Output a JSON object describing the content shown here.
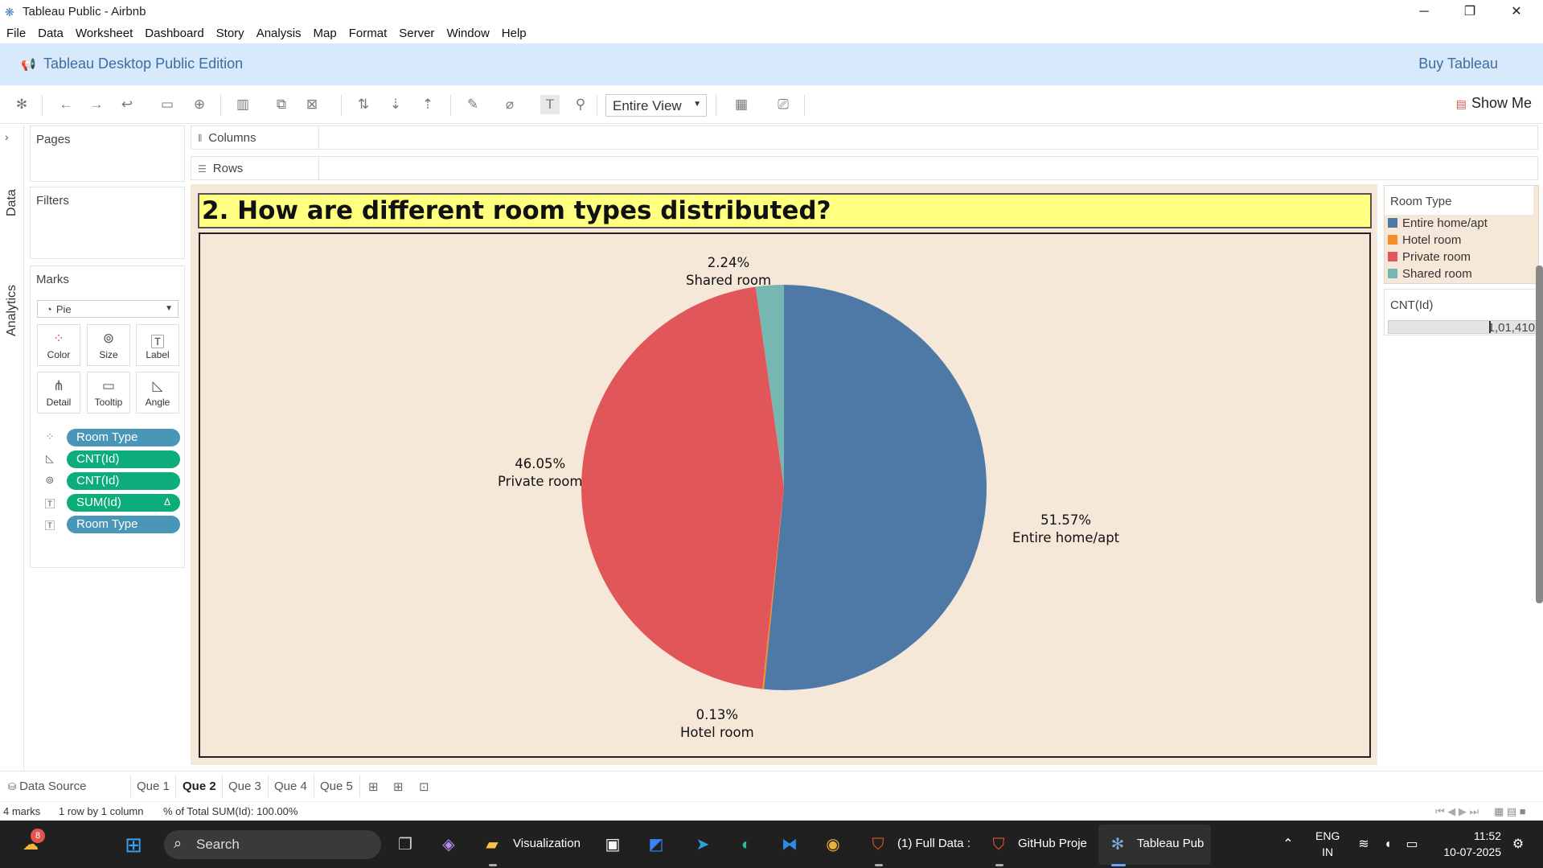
{
  "window": {
    "title": "Tableau Public - Airbnb",
    "minimize": "─",
    "restore": "❐",
    "close": "✕"
  },
  "menu": [
    "File",
    "Data",
    "Worksheet",
    "Dashboard",
    "Story",
    "Analysis",
    "Map",
    "Format",
    "Server",
    "Window",
    "Help"
  ],
  "banner": {
    "edition": "Tableau Desktop Public Edition",
    "buy": "Buy Tableau"
  },
  "toolbar": {
    "fit": "Entire View",
    "show_me": "Show Me"
  },
  "rail": {
    "data_tab": "Data",
    "analytics_tab": "Analytics"
  },
  "pages": {
    "title": "Pages"
  },
  "filters": {
    "title": "Filters"
  },
  "marks": {
    "title": "Marks",
    "mark_type": "Pie",
    "buttons": [
      "Color",
      "Size",
      "Label",
      "Detail",
      "Tooltip",
      "Angle"
    ],
    "pills": [
      {
        "field": "Room Type",
        "kind": "color"
      },
      {
        "field": "CNT(Id)",
        "kind": "angle"
      },
      {
        "field": "CNT(Id)",
        "kind": "size"
      },
      {
        "field": "SUM(Id)",
        "kind": "label",
        "flag": "Δ"
      },
      {
        "field": "Room Type",
        "kind": "label"
      }
    ]
  },
  "shelves": {
    "columns": "Columns",
    "rows": "Rows"
  },
  "sheet": {
    "title": "2. How are different room types distributed?"
  },
  "chart_data": {
    "type": "pie",
    "title": "2. How are different room types distributed?",
    "categories": [
      "Entire home/apt",
      "Hotel room",
      "Private room",
      "Shared room"
    ],
    "values": [
      51.57,
      0.13,
      46.05,
      2.24
    ],
    "labels": [
      "51.57%",
      "0.13%",
      "46.05%",
      "2.24%"
    ],
    "colors": [
      "#4e79a7",
      "#f28e2b",
      "#e15759",
      "#76b7b2"
    ],
    "legend_position": "right"
  },
  "legend": {
    "title": "Room Type",
    "items": [
      "Entire home/apt",
      "Hotel room",
      "Private room",
      "Shared room"
    ]
  },
  "size_card": {
    "title": "CNT(Id)",
    "value": "1,01,410"
  },
  "tabs": {
    "data_source": "Data Source",
    "sheets": [
      "Que 1",
      "Que 2",
      "Que 3",
      "Que 4",
      "Que 5"
    ],
    "active": "Que 2"
  },
  "status": {
    "marks": "4 marks",
    "dims": "1 row by 1 column",
    "summary": "% of Total SUM(Id): 100.00%"
  },
  "taskbar": {
    "badge": "8",
    "search": "Search",
    "apps": [
      "Visualization",
      "(1) Full Data :",
      "GitHub Proje",
      "Tableau Pub"
    ],
    "lang_1": "ENG",
    "lang_2": "IN",
    "time": "11:52",
    "date": "10-07-2025"
  }
}
